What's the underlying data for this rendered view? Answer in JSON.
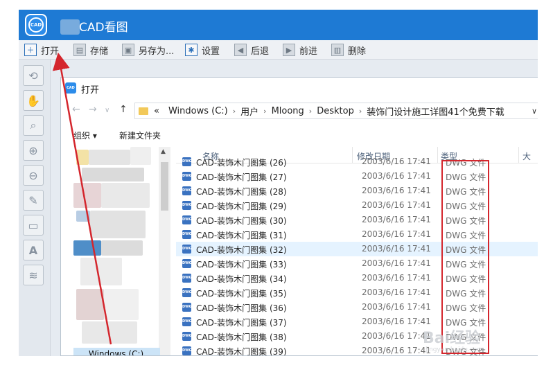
{
  "app": {
    "title": "CAD看图",
    "logo_text": "CAD"
  },
  "toolbar": {
    "open": "打开",
    "save": "存储",
    "save_as": "另存为...",
    "settings": "设置",
    "back": "后退",
    "forward": "前进",
    "delete": "删除"
  },
  "dialog": {
    "logo_text": "CAD",
    "title": "打开",
    "breadcrumb": [
      "«",
      "Windows (C:)",
      "用户",
      "Mloong",
      "Desktop",
      "装饰门设计施工详图41个免费下载"
    ],
    "organize": "组织 ▾",
    "new_folder": "新建文件夹",
    "nav_drive": "Windows (C:)",
    "columns": {
      "name": "名称",
      "date": "修改日期",
      "type": "类型",
      "size": "大"
    },
    "files": [
      {
        "name": "CAD-装饰木门图集 (26)",
        "date": "2003/6/16 17:41",
        "type": "DWG 文件"
      },
      {
        "name": "CAD-装饰木门图集 (27)",
        "date": "2003/6/16 17:41",
        "type": "DWG 文件"
      },
      {
        "name": "CAD-装饰木门图集 (28)",
        "date": "2003/6/16 17:41",
        "type": "DWG 文件"
      },
      {
        "name": "CAD-装饰木门图集 (29)",
        "date": "2003/6/16 17:41",
        "type": "DWG 文件"
      },
      {
        "name": "CAD-装饰木门图集 (30)",
        "date": "2003/6/16 17:41",
        "type": "DWG 文件"
      },
      {
        "name": "CAD-装饰木门图集 (31)",
        "date": "2003/6/16 17:41",
        "type": "DWG 文件"
      },
      {
        "name": "CAD-装饰木门图集 (32)",
        "date": "2003/6/16 17:41",
        "type": "DWG 文件"
      },
      {
        "name": "CAD-装饰木门图集 (33)",
        "date": "2003/6/16 17:41",
        "type": "DWG 文件"
      },
      {
        "name": "CAD-装饰木门图集 (34)",
        "date": "2003/6/16 17:41",
        "type": "DWG 文件"
      },
      {
        "name": "CAD-装饰木门图集 (35)",
        "date": "2003/6/16 17:41",
        "type": "DWG 文件"
      },
      {
        "name": "CAD-装饰木门图集 (36)",
        "date": "2003/6/16 17:41",
        "type": "DWG 文件"
      },
      {
        "name": "CAD-装饰木门图集 (37)",
        "date": "2003/6/16 17:41",
        "type": "DWG 文件"
      },
      {
        "name": "CAD-装饰木门图集 (38)",
        "date": "2003/6/16 17:41",
        "type": "DWG 文件"
      },
      {
        "name": "CAD-装饰木门图集 (39)",
        "date": "2003/6/16 17:41",
        "type": "DWG 文件"
      }
    ],
    "selected_index": 6,
    "file_icon_text": "DWG"
  },
  "watermark": {
    "text": "Bai经验",
    "sub": "jingyan.baidu.com"
  },
  "colors": {
    "title_bar": "#1e7ad4",
    "highlight_box": "#d4262d",
    "arrow": "#d4262d",
    "selected_row": "#e5f3ff"
  },
  "icons": [
    "plus-icon",
    "save-icon",
    "save-as-icon",
    "gear-icon",
    "back-arrow-icon",
    "forward-arrow-icon",
    "trash-icon",
    "zoom-rotate-icon",
    "pan-hand-icon",
    "zoom-window-icon",
    "zoom-in-icon",
    "zoom-out-icon",
    "pencil-icon",
    "measure-ruler-icon",
    "text-a-icon",
    "layers-icon"
  ]
}
